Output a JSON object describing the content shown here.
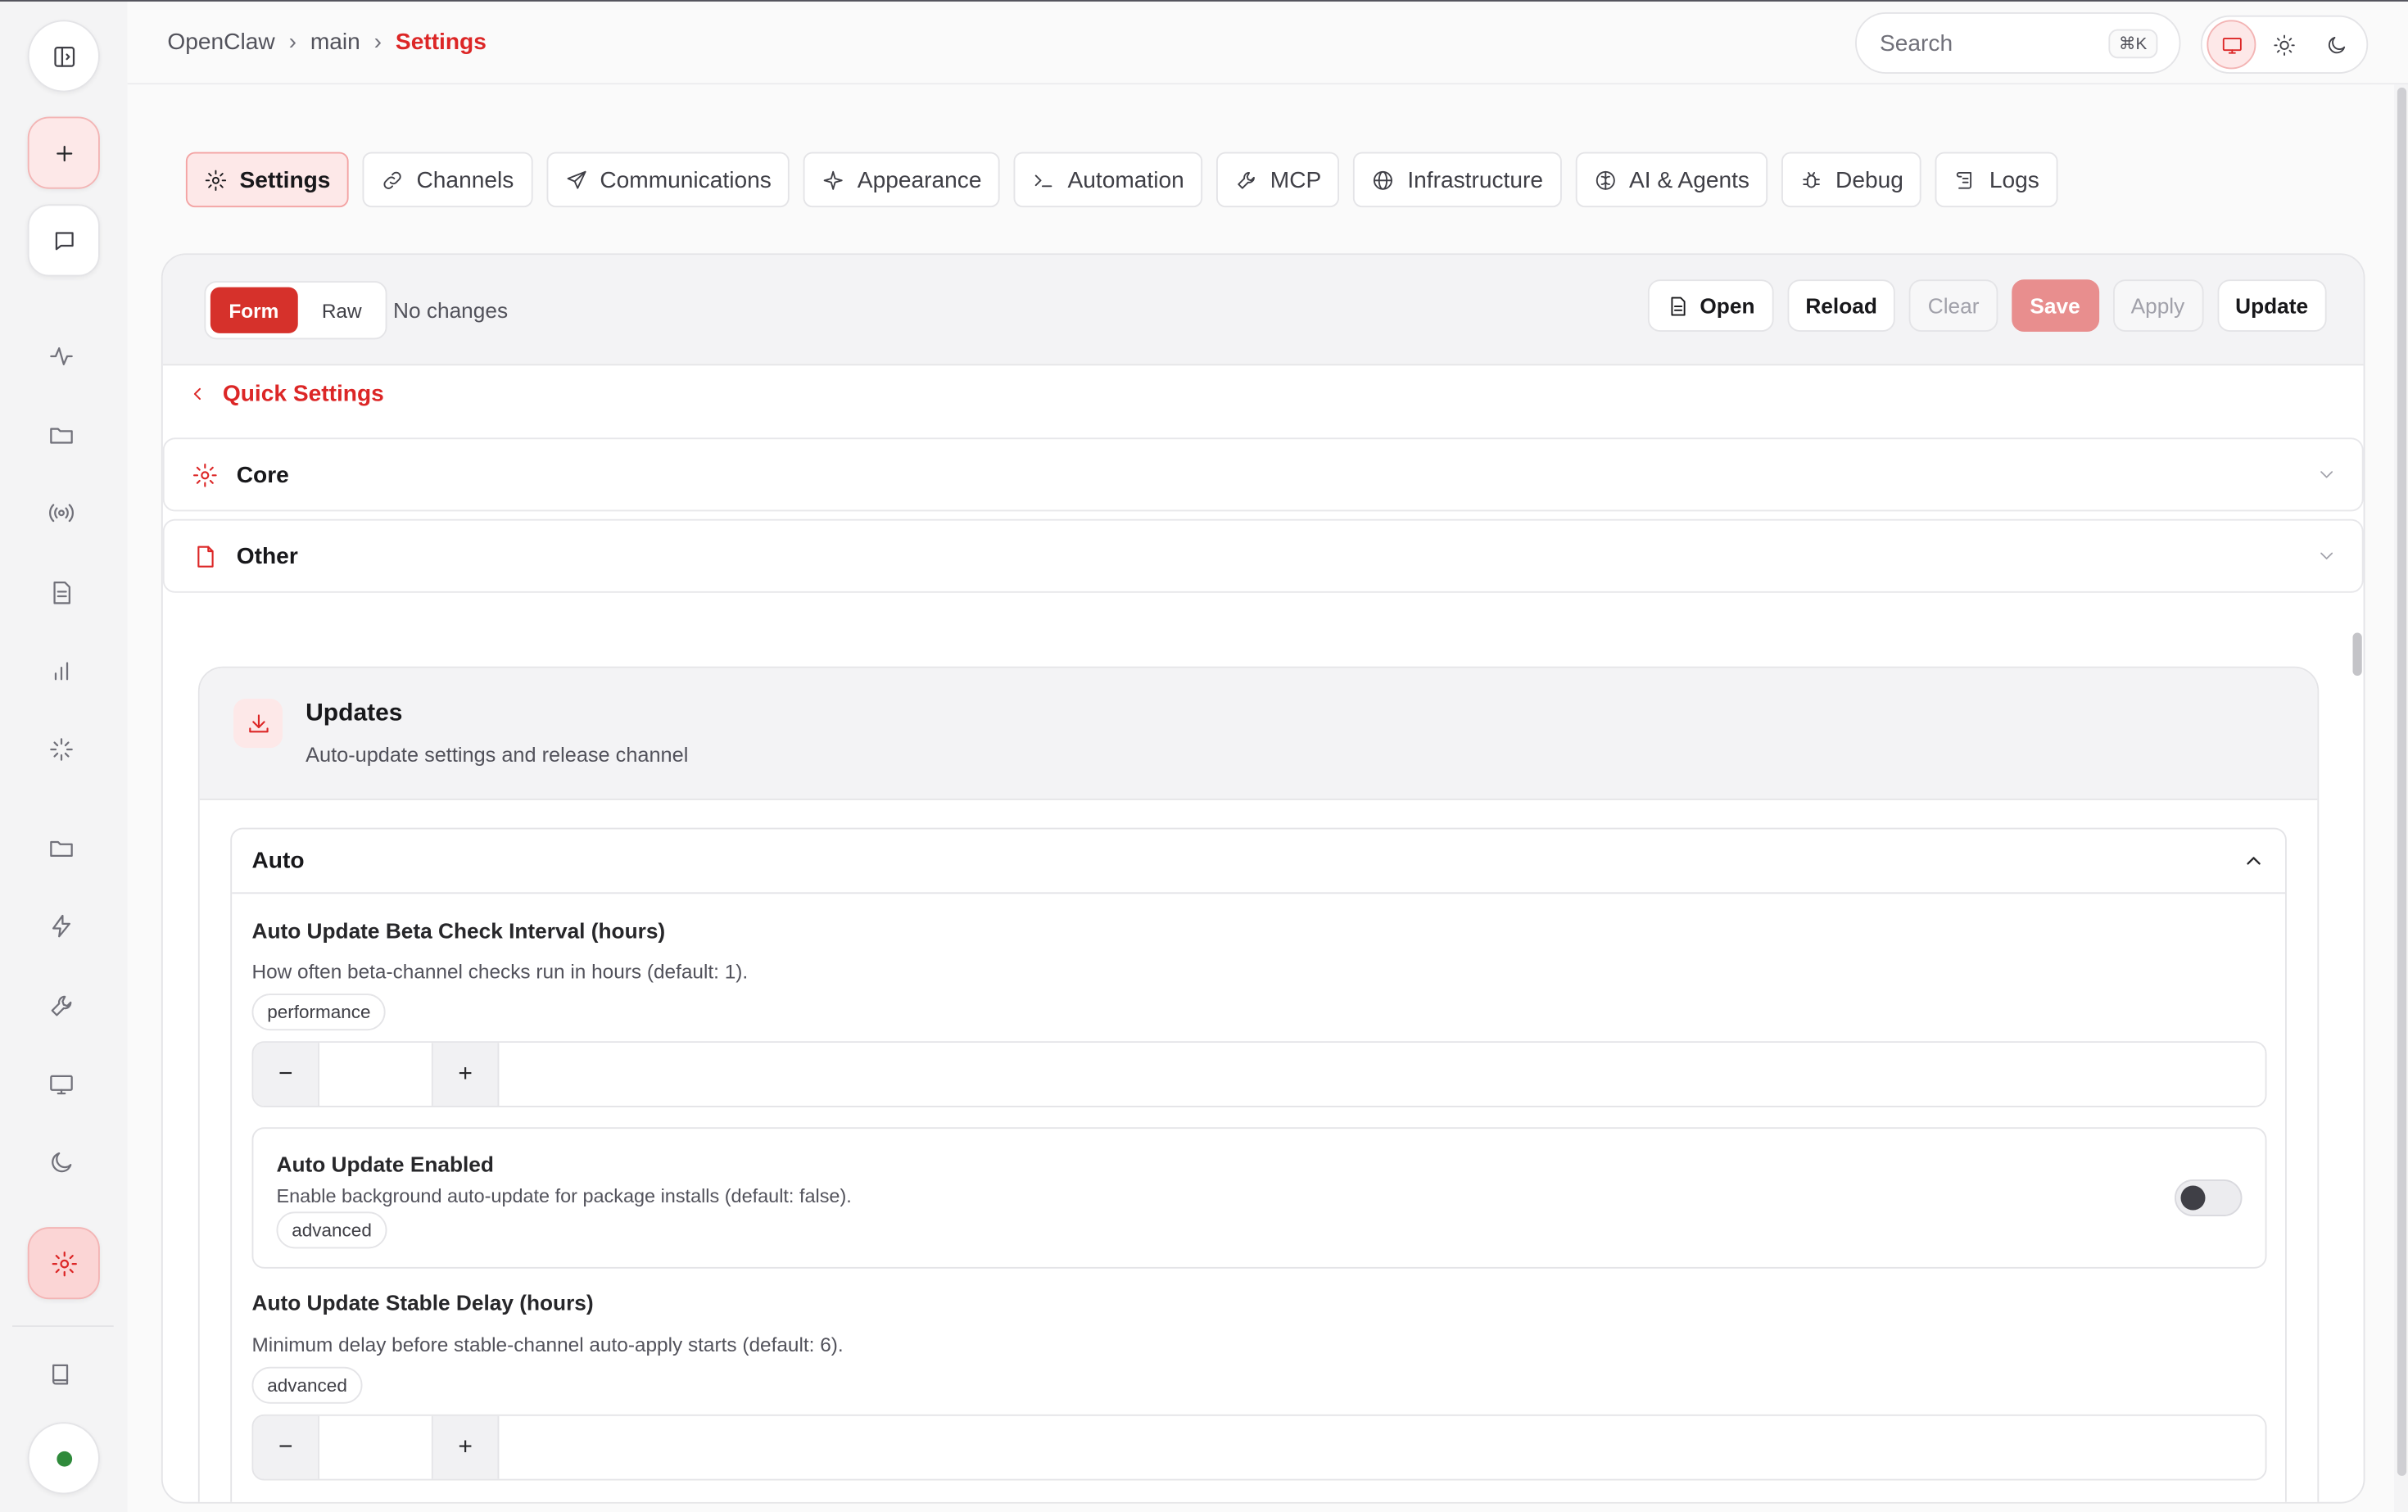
{
  "breadcrumb": {
    "root": "OpenClaw",
    "branch": "main",
    "current": "Settings",
    "separator": "›"
  },
  "search": {
    "placeholder": "Search",
    "shortcut": "⌘K"
  },
  "theme": {
    "options": [
      "system",
      "light",
      "dark"
    ],
    "selected": "system"
  },
  "rail": {
    "icons": [
      "sidebar-toggle-icon",
      "plus-icon",
      "chat-icon",
      "activity-icon",
      "folder-icon",
      "broadcast-icon",
      "document-icon",
      "bar-chart-icon",
      "loader-icon",
      "folder-icon",
      "lightning-icon",
      "wrench-icon",
      "monitor-icon",
      "moon-icon",
      "gear-icon",
      "book-icon",
      "status-dot"
    ],
    "active": "settings",
    "status_color": "#2f8a3b"
  },
  "tabs": [
    {
      "label": "Settings",
      "icon": "gear-icon",
      "active": true
    },
    {
      "label": "Channels",
      "icon": "link-icon"
    },
    {
      "label": "Communications",
      "icon": "send-icon"
    },
    {
      "label": "Appearance",
      "icon": "sparkle-icon"
    },
    {
      "label": "Automation",
      "icon": "terminal-icon"
    },
    {
      "label": "MCP",
      "icon": "wrench-icon"
    },
    {
      "label": "Infrastructure",
      "icon": "globe-icon"
    },
    {
      "label": "AI & Agents",
      "icon": "brain-icon"
    },
    {
      "label": "Debug",
      "icon": "bug-icon"
    },
    {
      "label": "Logs",
      "icon": "scroll-icon"
    }
  ],
  "toolbar": {
    "mode_form": "Form",
    "mode_raw": "Raw",
    "mode_selected": "Form",
    "status": "No changes",
    "open_label": "Open",
    "reload_label": "Reload",
    "clear_label": "Clear",
    "save_label": "Save",
    "apply_label": "Apply",
    "update_label": "Update"
  },
  "quick_settings": {
    "label": "Quick Settings"
  },
  "sections": [
    {
      "label": "Core",
      "icon": "gear-icon",
      "expanded": false
    },
    {
      "label": "Other",
      "icon": "file-icon",
      "expanded": false
    }
  ],
  "updates": {
    "title": "Updates",
    "description": "Auto-update settings and release channel",
    "group": {
      "label": "Auto",
      "expanded": true,
      "fields": {
        "beta_interval": {
          "title": "Auto Update Beta Check Interval (hours)",
          "description": "How often beta-channel checks run in hours (default: 1).",
          "tag": "performance",
          "value": ""
        },
        "enabled": {
          "title": "Auto Update Enabled",
          "description": "Enable background auto-update for package installs (default: false).",
          "tag": "advanced",
          "value": false
        },
        "stable_delay": {
          "title": "Auto Update Stable Delay (hours)",
          "description": "Minimum delay before stable-channel auto-apply starts (default: 6).",
          "tag": "advanced",
          "value": ""
        }
      }
    }
  },
  "stepper": {
    "minus": "−",
    "plus": "+"
  },
  "colors": {
    "accent": "#dc2626",
    "accent_soft": "#fde8e8",
    "save_disabled": "#e88e8e"
  }
}
